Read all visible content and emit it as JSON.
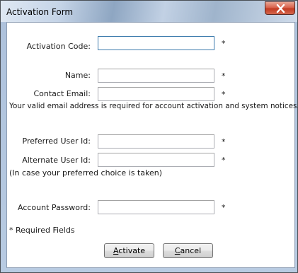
{
  "window": {
    "title": "Activation Form"
  },
  "form": {
    "activation_code": {
      "label": "Activation Code:",
      "value": "",
      "required_mark": "*"
    },
    "name": {
      "label": "Name:",
      "value": "",
      "required_mark": "*"
    },
    "contact_email": {
      "label": "Contact Email:",
      "value": "",
      "required_mark": "*"
    },
    "email_note": "Your valid email address is required for account activation and system notices.",
    "preferred_user_id": {
      "label": "Preferred User Id:",
      "value": "",
      "required_mark": "*"
    },
    "alternate_user_id": {
      "label": "Alternate User Id:",
      "value": "",
      "required_mark": "*"
    },
    "alternate_note": "(In case your preferred choice is taken)",
    "account_password": {
      "label": "Account Password:",
      "value": "",
      "required_mark": "*"
    },
    "required_fields_note": "* Required Fields"
  },
  "buttons": {
    "activate": {
      "mnemonic": "A",
      "rest": "ctivate"
    },
    "cancel": {
      "mnemonic": "C",
      "rest": "ancel"
    }
  },
  "icons": {
    "close": "close-icon"
  }
}
